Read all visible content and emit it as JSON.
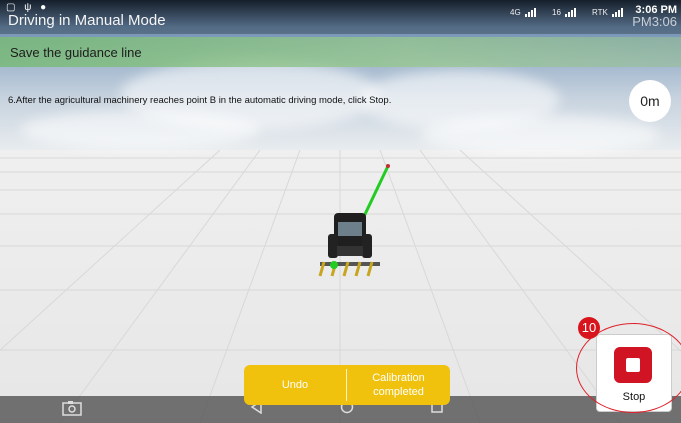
{
  "status_bar": {
    "window_title": "Driving in Manual Mode",
    "signal_4g": "4G",
    "signal_sat": "16",
    "signal_rtk": "RTK",
    "clock": "3:06 PM",
    "clock_ghost": "PM3:06"
  },
  "banner": {
    "title": "Save the guidance line"
  },
  "instruction": "6.After the agricultural machinery reaches point B in the automatic driving mode, click Stop.",
  "distance": "0m",
  "buttons": {
    "undo": "Undo",
    "calibration": "Calibration completed",
    "stop": "Stop"
  },
  "annotation": {
    "step_number": "10"
  },
  "colors": {
    "accent_yellow": "#f0c20e",
    "stop_red": "#d01424",
    "guidance_line": "#22cc22",
    "annotation_red": "#e0202a"
  },
  "icons": [
    "camera-icon",
    "back-icon",
    "home-icon",
    "recents-icon",
    "stop-icon",
    "tractor-icon"
  ]
}
